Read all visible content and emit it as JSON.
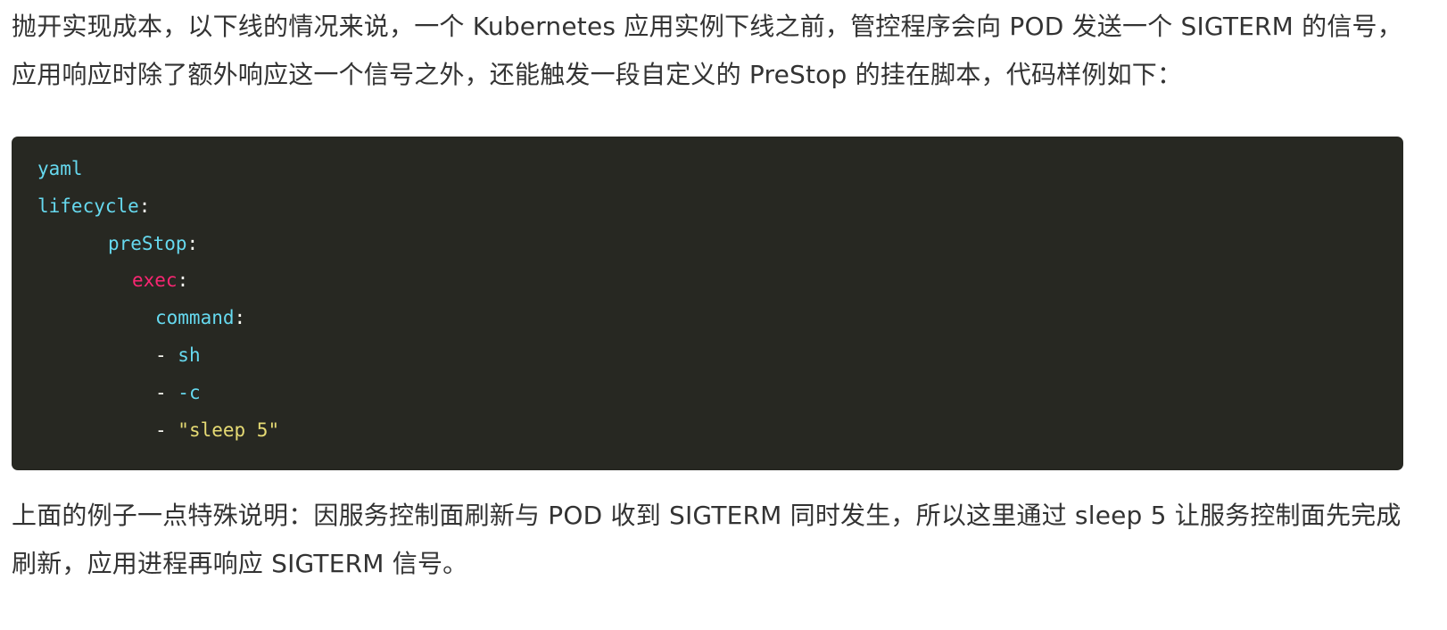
{
  "intro_paragraph": "抛开实现成本，以下线的情况来说，一个 Kubernetes 应用实例下线之前，管控程序会向 POD 发送一个 SIGTERM 的信号，应用响应时除了额外响应这一个信号之外，还能触发一段自定义的 PreStop 的挂在脚本，代码样例如下：",
  "code": {
    "language": "yaml",
    "lines": [
      {
        "key": "lifecycle",
        "punc": ":"
      },
      {
        "key": "preStop",
        "punc": ":"
      },
      {
        "key": "exec",
        "punc": ":"
      },
      {
        "key": "command",
        "punc": ":"
      },
      {
        "dash": "- ",
        "value": "sh"
      },
      {
        "dash": "- ",
        "value": "-c"
      },
      {
        "dash": "- ",
        "value": "\"sleep 5\""
      }
    ],
    "colors": {
      "background": "#272822",
      "key": "#66d9ef",
      "exec": "#f92672",
      "string": "#e6db74",
      "text": "#f8f8f2"
    }
  },
  "note_paragraph": "上面的例子一点特殊说明：因服务控制面刷新与 POD 收到 SIGTERM 同时发生，所以这里通过 sleep 5 让服务控制面先完成刷新，应用进程再响应 SIGTERM 信号。"
}
